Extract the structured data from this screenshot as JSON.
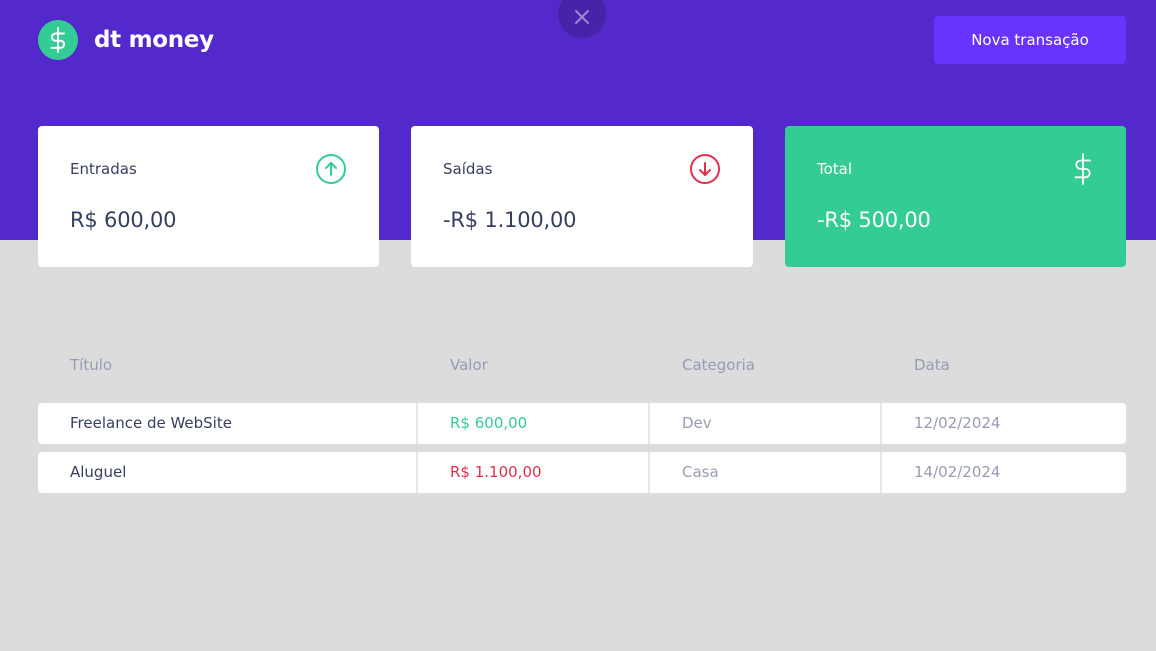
{
  "header": {
    "app_name": "dt money",
    "new_transaction_label": "Nova transação",
    "close_icon": "close-icon",
    "logo_icon": "dollar-sign-icon"
  },
  "summary": {
    "income": {
      "label": "Entradas",
      "value": "R$ 600,00",
      "icon": "arrow-up-circle-icon"
    },
    "outcome": {
      "label": "Saídas",
      "value": "-R$ 1.100,00",
      "icon": "arrow-down-circle-icon"
    },
    "total": {
      "label": "Total",
      "value": "-R$ 500,00",
      "icon": "dollar-sign-icon"
    }
  },
  "table": {
    "headers": [
      "Título",
      "Valor",
      "Categoria",
      "Data"
    ],
    "rows": [
      {
        "title": "Freelance de WebSite",
        "amount": "R$ 600,00",
        "type": "deposit",
        "category": "Dev",
        "date": "12/02/2024"
      },
      {
        "title": "Aluguel",
        "amount": "R$ 1.100,00",
        "type": "withdraw",
        "category": "Casa",
        "date": "14/02/2024"
      }
    ]
  },
  "colors": {
    "header_bg": "#5429cc",
    "page_bg": "#dcdcdc",
    "green": "#33cc95",
    "red": "#e52e4d",
    "button": "#6933ff",
    "text": "#363f5f",
    "muted": "#969cb3"
  }
}
